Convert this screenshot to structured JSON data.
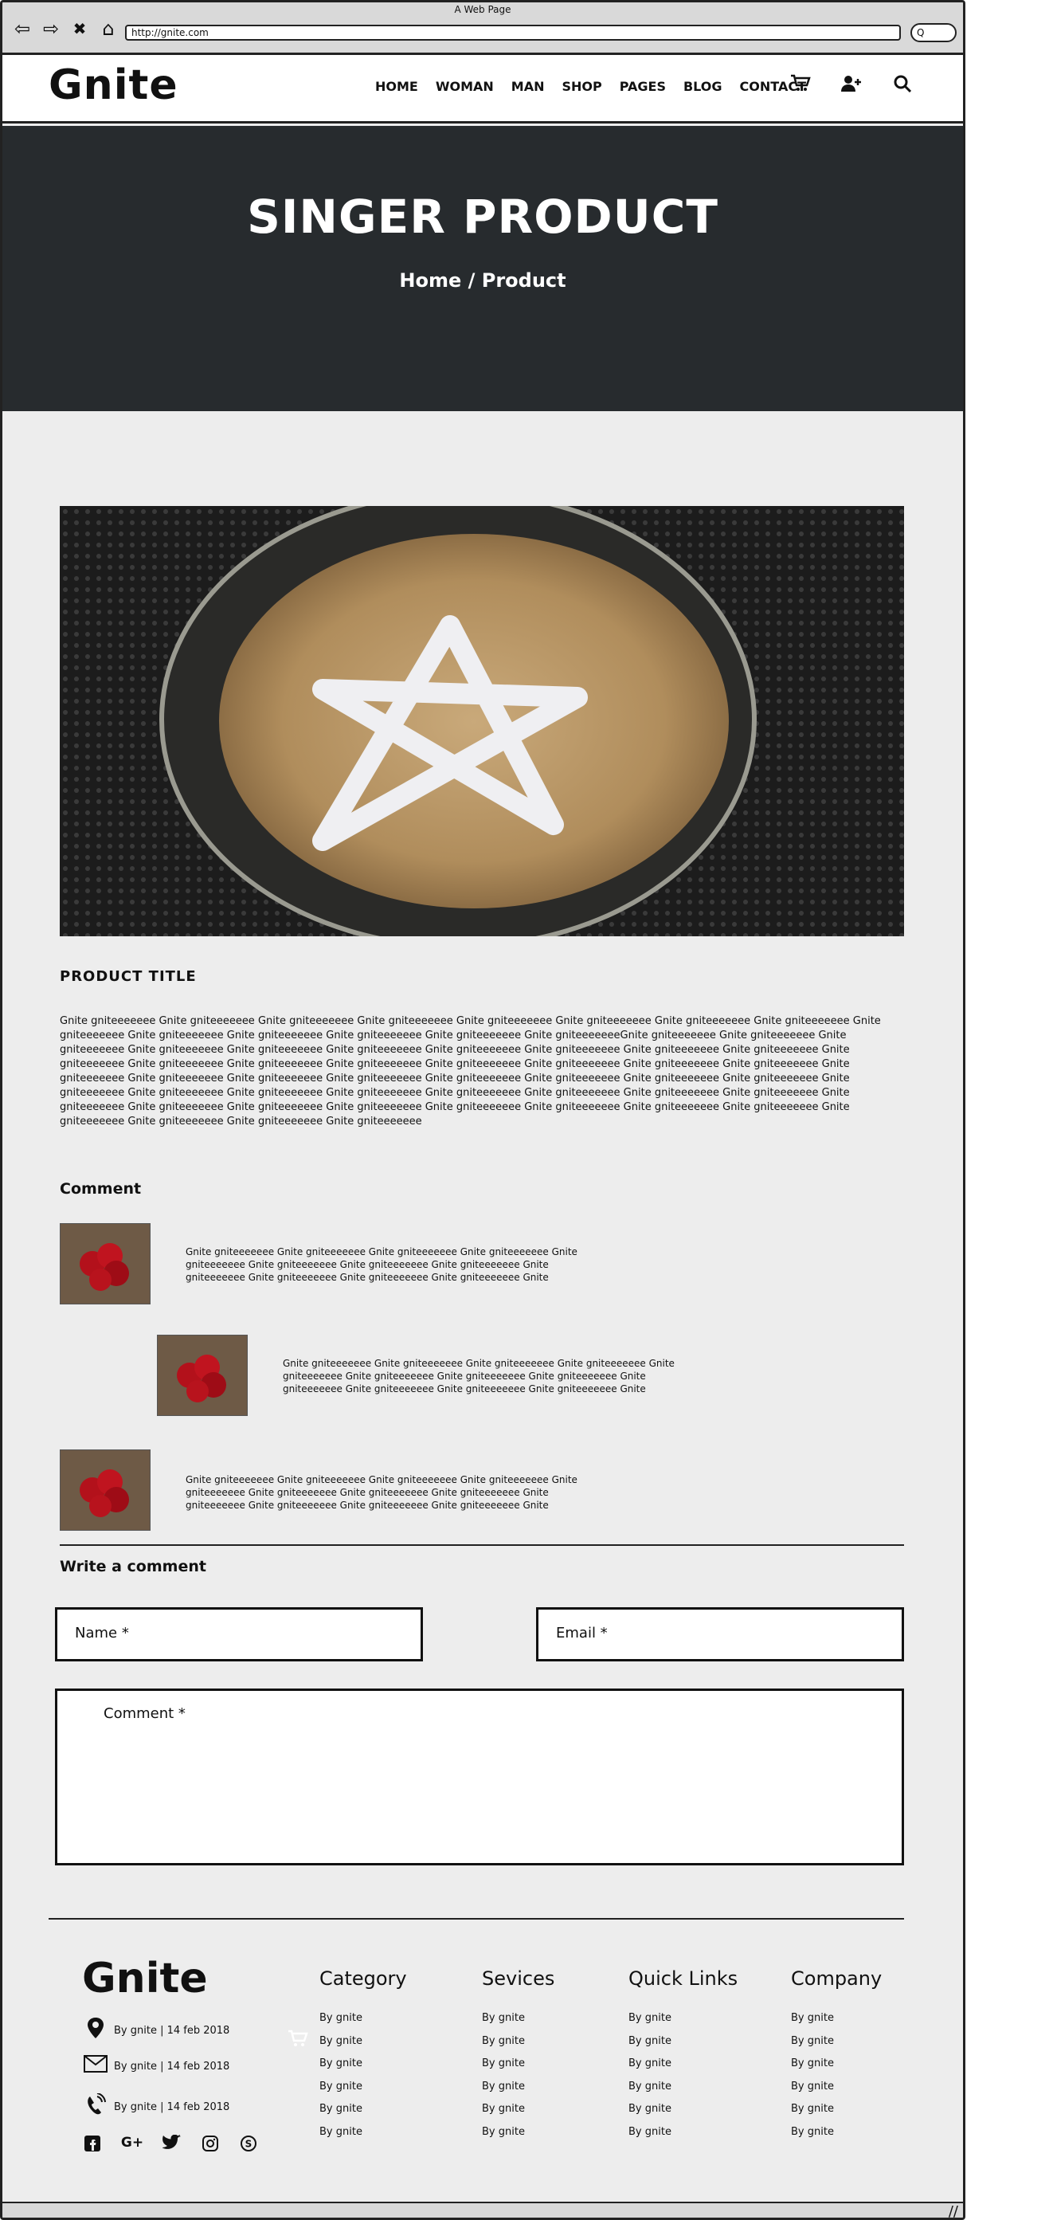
{
  "browser": {
    "title": "A Web Page",
    "url": "http://gnite.com",
    "search_placeholder": "Q"
  },
  "header": {
    "logo": "Gnite",
    "menu": [
      "HOME",
      "WOMAN",
      "MAN",
      "SHOP",
      "PAGES",
      "BLOG",
      "CONTACT"
    ],
    "icons": [
      "cart-icon",
      "add-user-icon",
      "search-icon"
    ]
  },
  "hero": {
    "title": "SINGER PRODUCT",
    "breadcrumb": "Home / Product"
  },
  "product": {
    "image_desc": "coffee-with-star-cream",
    "title": "PRODUCT TITLE",
    "description": "Gnite gniteeeeeee Gnite gniteeeeeee Gnite gniteeeeeee Gnite gniteeeeeee Gnite gniteeeeeee  Gnite gniteeeeeee Gnite gniteeeeeee Gnite gniteeeeeee Gnite gniteeeeeee Gnite gniteeeeeee  Gnite gniteeeeeee Gnite gniteeeeeee Gnite gniteeeeeee Gnite gniteeeeeeeGnite gniteeeeeee Gnite gniteeeeeee Gnite gniteeeeeee Gnite gniteeeeeee Gnite gniteeeeeee  Gnite gniteeeeeee Gnite gniteeeeeee Gnite gniteeeeeee Gnite gniteeeeeee Gnite gniteeeeeee  Gnite gniteeeeeee Gnite gniteeeeeee Gnite gniteeeeeee Gnite gniteeeeeee Gnite gniteeeeeee Gnite gniteeeeeee Gnite gniteeeeeee Gnite gniteeeeeee Gnite gniteeeeeee Gnite gniteeeeeee  Gnite gniteeeeeee Gnite gniteeeeeee Gnite gniteeeeeee Gnite gniteeeeeee Gnite gniteeeeeee Gnite gniteeeeeee  Gnite gniteeeeeee Gnite gniteeeeeee Gnite gniteeeeeee Gnite gniteeeeeee Gnite gniteeeeeee Gnite gniteeeeeee Gnite gniteeeeeee Gnite gniteeeeeee Gnite gniteeeeeee  Gnite gniteeeeeee Gnite gniteeeeeee Gnite gniteeeeeee Gnite gniteeeeeee Gnite gniteeeeeee  Gnite gniteeeeeee Gnite gniteeeeeee Gnite gniteeeeeee Gnite gniteeeeeee Gnite gniteeeeeee Gnite gniteeeeeee"
  },
  "comments": {
    "heading": "Comment",
    "items": [
      {
        "text": "Gnite gniteeeeeee Gnite gniteeeeeee Gnite gniteeeeeee Gnite gniteeeeeee Gnite gniteeeeeee  Gnite gniteeeeeee Gnite gniteeeeeee Gnite gniteeeeeee Gnite gniteeeeeee Gnite gniteeeeeee  Gnite gniteeeeeee Gnite gniteeeeeee Gnite"
      },
      {
        "text": "Gnite gniteeeeeee Gnite gniteeeeeee Gnite gniteeeeeee Gnite gniteeeeeee Gnite gniteeeeeee  Gnite gniteeeeeee Gnite gniteeeeeee Gnite gniteeeeeee Gnite gniteeeeeee Gnite gniteeeeeee  Gnite gniteeeeeee Gnite gniteeeeeee Gnite"
      },
      {
        "text": "Gnite gniteeeeeee Gnite gniteeeeeee Gnite gniteeeeeee Gnite gniteeeeeee Gnite gniteeeeeee  Gnite gniteeeeeee Gnite gniteeeeeee Gnite gniteeeeeee Gnite gniteeeeeee Gnite gniteeeeeee  Gnite gniteeeeeee Gnite gniteeeeeee Gnite"
      }
    ]
  },
  "form": {
    "heading": "Write a comment",
    "name_label": "Name *",
    "email_label": "Email *",
    "comment_label": "Comment *"
  },
  "footer": {
    "logo": "Gnite",
    "contact": [
      {
        "icon": "location-pin-icon",
        "text": "By gnite | 14 feb 2018"
      },
      {
        "icon": "envelope-icon",
        "text": "By gnite | 14 feb 2018"
      },
      {
        "icon": "phone-icon",
        "text": "By gnite | 14 feb 2018"
      }
    ],
    "social": [
      "facebook-icon",
      "google-plus-icon",
      "twitter-icon",
      "instagram-icon",
      "skype-icon"
    ],
    "columns": [
      {
        "title": "Category",
        "links": [
          "By gnite",
          "By gnite",
          "By gnite",
          "By gnite",
          "By gnite",
          "By gnite"
        ]
      },
      {
        "title": "Sevices",
        "links": [
          "By gnite",
          "By gnite",
          "By gnite",
          "By gnite",
          "By gnite",
          "By gnite"
        ]
      },
      {
        "title": "Quick Links",
        "links": [
          "By gnite",
          "By gnite",
          "By gnite",
          "By gnite",
          "By gnite",
          "By gnite"
        ]
      },
      {
        "title": "Company",
        "links": [
          "By gnite",
          "By gnite",
          "By gnite",
          "By gnite",
          "By gnite",
          "By gnite"
        ]
      }
    ]
  }
}
